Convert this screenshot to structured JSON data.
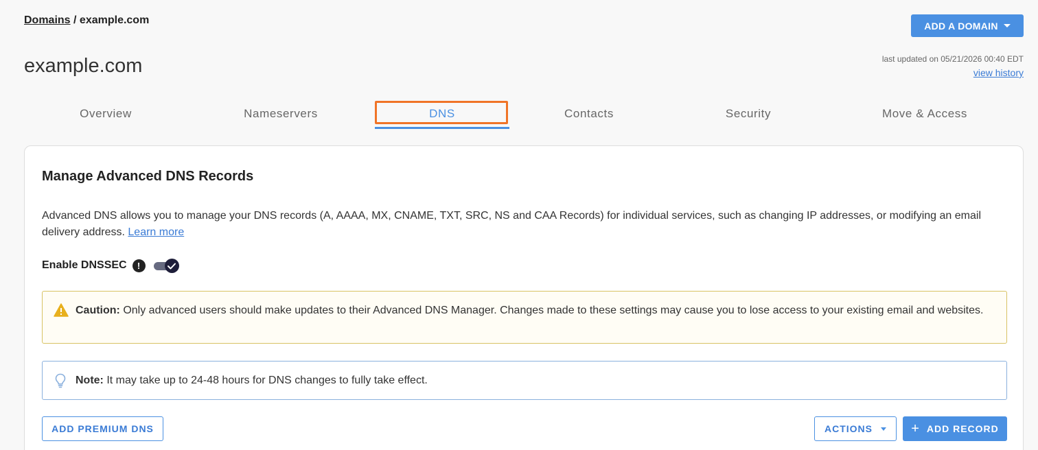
{
  "breadcrumb": {
    "link": "Domains",
    "separator": " / ",
    "current": "example.com"
  },
  "header": {
    "add_domain_label": "ADD A DOMAIN",
    "title": "example.com",
    "last_updated": "last updated on 05/21/2026 00:40 EDT",
    "view_history": "view history"
  },
  "tabs": [
    {
      "label": "Overview",
      "active": false
    },
    {
      "label": "Nameservers",
      "active": false
    },
    {
      "label": "DNS",
      "active": true
    },
    {
      "label": "Contacts",
      "active": false
    },
    {
      "label": "Security",
      "active": false
    },
    {
      "label": "Move & Access",
      "active": false
    }
  ],
  "card": {
    "title": "Manage Advanced DNS Records",
    "description": "Advanced DNS allows you to manage your DNS records (A, AAAA, MX, CNAME, TXT, SRC, NS and CAA Records) for individual services, such as changing IP addresses, or modifying an email delivery address. ",
    "learn_more": "Learn more",
    "dnssec_label": "Enable DNSSEC",
    "dnssec_info": "!",
    "dnssec_enabled": true,
    "caution_label": "Caution:",
    "caution_text": " Only advanced users should make updates to their Advanced DNS Manager. Changes made to these settings may cause you to lose access to your existing email and websites.",
    "note_label": "Note:",
    "note_text": " It may take up to 24-48 hours for DNS changes to fully take effect.",
    "add_premium_dns": "ADD PREMIUM DNS",
    "actions": "ACTIONS",
    "add_record_plus": "+",
    "add_record": "ADD RECORD"
  },
  "colors": {
    "accent": "#4a90e2",
    "highlight": "#f07427",
    "caution_border": "#d8c263",
    "caution_icon": "#e8b01d",
    "note_border": "#8ab0dd"
  },
  "icons": {
    "caution": "warning-triangle-icon",
    "note": "lightbulb-icon",
    "toggle": "check-icon"
  }
}
